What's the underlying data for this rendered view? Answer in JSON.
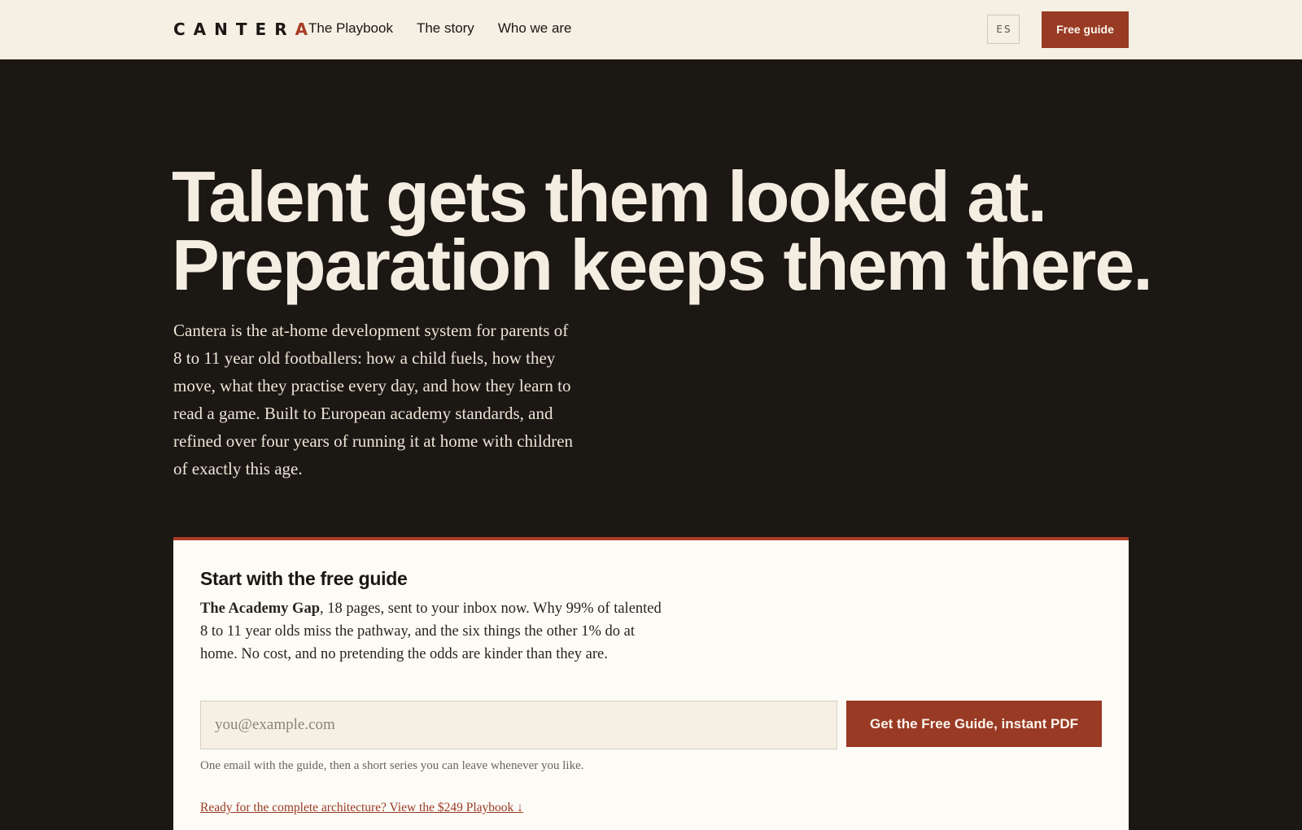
{
  "nav": {
    "logo_text": "CANTER",
    "logo_accent": "A",
    "links": [
      "The Playbook",
      "The story",
      "Who we are"
    ],
    "lang_label": "ES",
    "cta_label": "Free guide"
  },
  "hero": {
    "title_line1": "Talent gets them looked at.",
    "title_line2": "Preparation keeps them there.",
    "copy": "Cantera is the at-home development system for parents of 8 to 11 year old footballers: how a child fuels, how they move, what they practise every day, and how they learn to read a game. Built to European academy standards, and refined over four years of running it at home with children of exactly this age."
  },
  "signup": {
    "title": "Start with the free guide",
    "guide_name": "The Academy Gap",
    "copy": ", 18 pages, sent to your inbox now. Why 99% of talented 8 to 11 year olds miss the pathway, and the six things the other 1% do at home. No cost, and no pretending the odds are kinder than they are.",
    "email_placeholder": "you@example.com",
    "submit_label": "Get the Free Guide, instant PDF",
    "fine_print": "One email with the guide, then a short series you can leave whenever you like.",
    "upsell_link": "Ready for the complete architecture? View the $249 Playbook ↓"
  },
  "colors": {
    "background_dark": "#1b1713",
    "cream": "#f5efe4",
    "accent": "#993a24"
  }
}
